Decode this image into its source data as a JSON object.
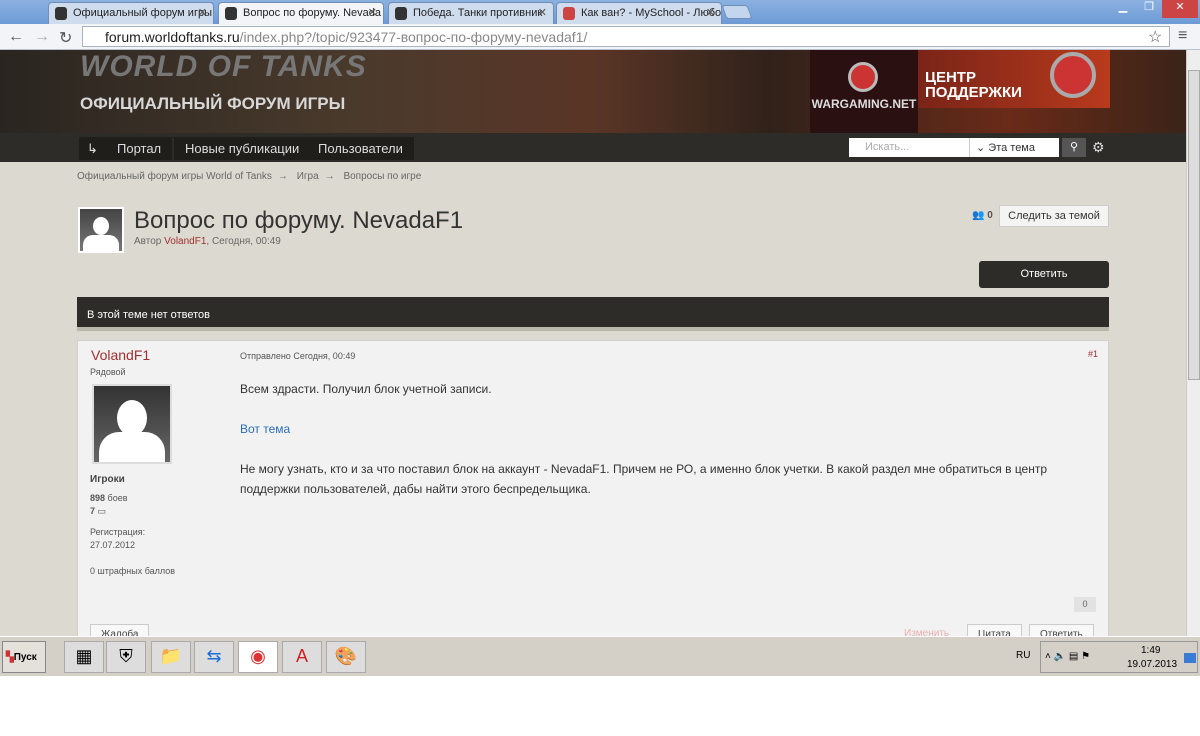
{
  "browser": {
    "tabs": [
      {
        "title": "Официальный форум игры"
      },
      {
        "title": "Вопрос по форуму. Nevada"
      },
      {
        "title": "Победа. Танки противник"
      },
      {
        "title": "Как ван? - MySchool - Любо"
      }
    ],
    "url_host": "forum.worldoftanks.ru",
    "url_path": "/index.php?/topic/923477-вопрос-по-форуму-nevadaf1/"
  },
  "banner": {
    "logo": "WORLD OF TANKS",
    "subtitle": "ОФИЦИАЛЬНЫЙ ФОРУМ ИГРЫ",
    "wargaming": "WARGAMING.NET",
    "support_line1": "ЦЕНТР",
    "support_line2": "ПОДДЕРЖКИ"
  },
  "nav": {
    "items": [
      "Портал",
      "Новые публикации",
      "Пользователи"
    ],
    "search_placeholder": "Искать...",
    "search_scope": "Эта тема"
  },
  "breadcrumb": [
    "Официальный форум игры World of Tanks",
    "Игра",
    "Вопросы по игре"
  ],
  "topic": {
    "title": "Вопрос по форуму. NevadaF1",
    "author_label": "Автор",
    "author": "VolandF1",
    "date": ", Сегодня, 00:49",
    "followers": "0",
    "follow_label": "Следить за темой",
    "reply_label": "Ответить",
    "no_replies": "В этой теме нет ответов"
  },
  "post": {
    "user": "VolandF1",
    "rank": "Рядовой",
    "group": "Игроки",
    "battles": "898",
    "battles_label": "боев",
    "posts": "7",
    "reg_label": "Регистрация:",
    "reg_date": "27.07.2012",
    "penalty": "0 штрафных баллов",
    "posted": "Отправлено Сегодня, 00:49",
    "number": "#1",
    "p1": "Всем здрасти. Получил блок учетной записи.",
    "link": "Вот тема",
    "p2": "Не могу узнать, кто и за что поставил блок на аккаунт - NevadaF1. Причем не РО, а именно блок учетки. В какой раздел мне обратиться в центр поддержки пользователей, дабы найти этого беспредельщика.",
    "reputation": "0",
    "report": "Жалоба",
    "edit": "Изменить",
    "quote": "Цитата",
    "reply": "Ответить"
  },
  "taskbar": {
    "start": "Пуск",
    "lang": "RU",
    "time": "1:49",
    "date": "19.07.2013"
  }
}
